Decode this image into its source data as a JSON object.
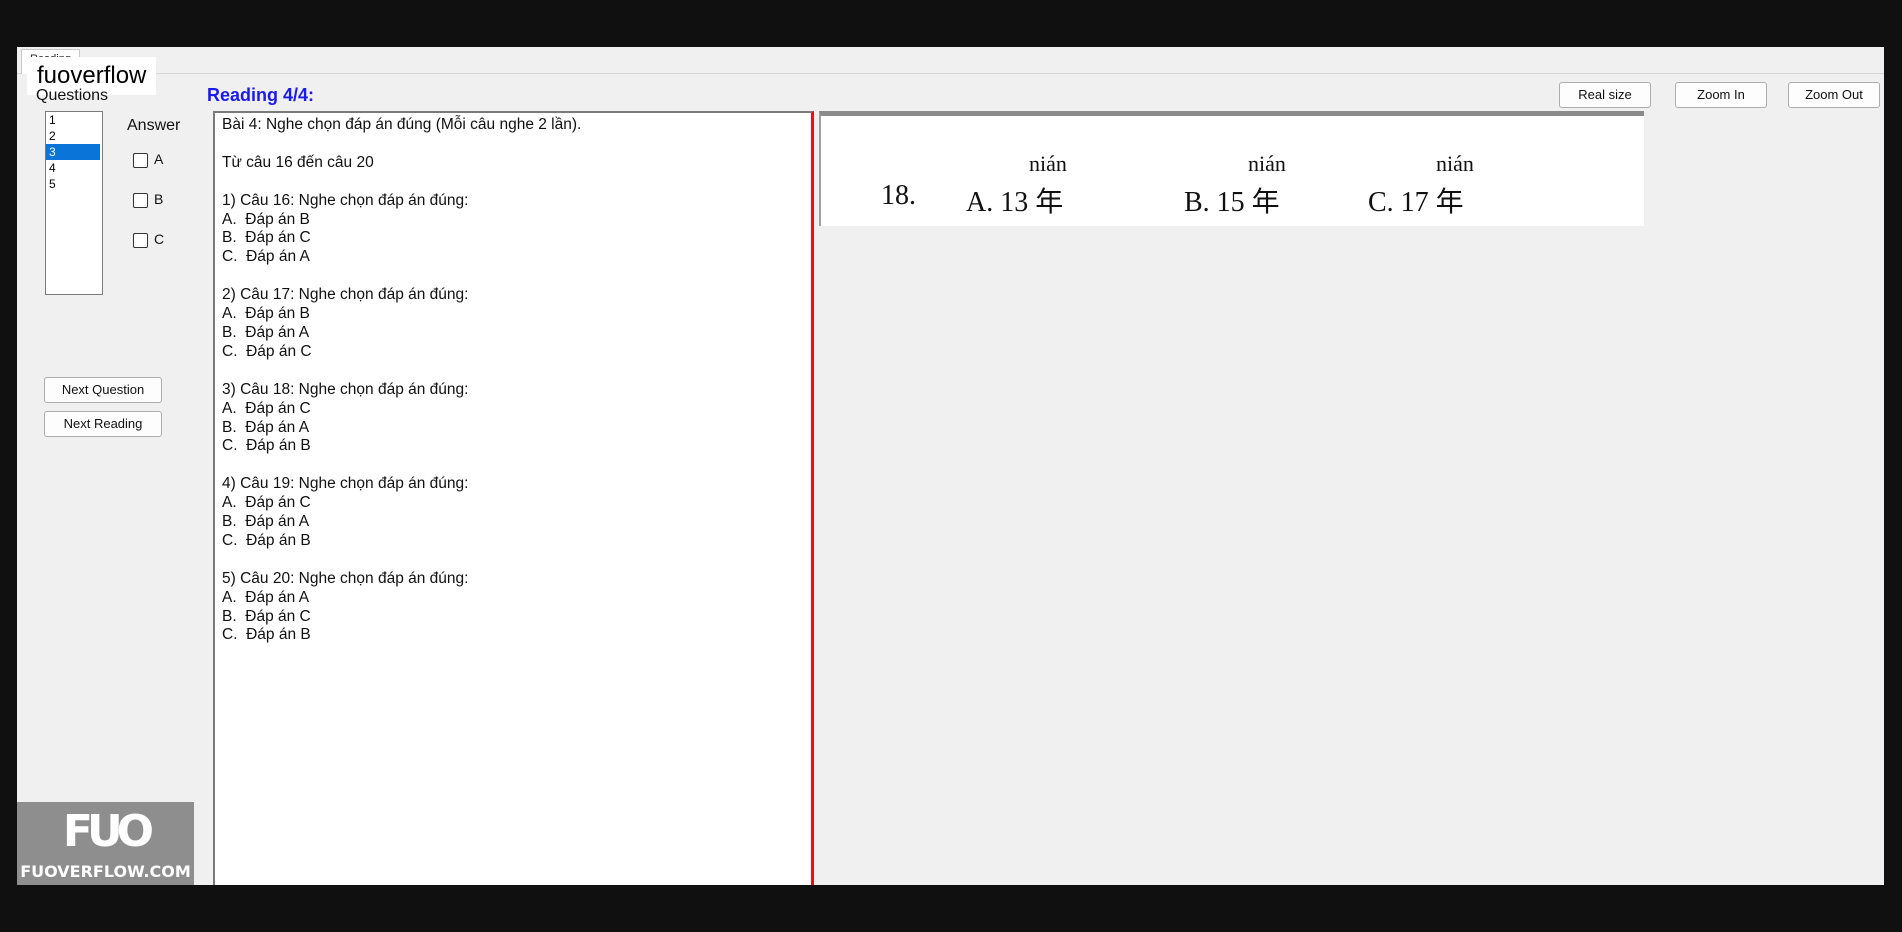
{
  "window": {
    "tab_label": "Reading"
  },
  "watermark": "fuoverflow",
  "questions": {
    "label": "Questions",
    "items": [
      "1",
      "2",
      "3",
      "4",
      "5"
    ],
    "selected": "3"
  },
  "reading": {
    "title": "Reading 4/4:"
  },
  "answer": {
    "label": "Answer",
    "options": [
      "A",
      "B",
      "C"
    ]
  },
  "buttons": {
    "next_question": "Next Question",
    "next_reading": "Next Reading",
    "real_size": "Real size",
    "zoom_in": "Zoom In",
    "zoom_out": "Zoom Out"
  },
  "content": {
    "text": "Bài 4: Nghe chọn đáp án đúng (Mỗi câu nghe 2 lần).\n\nTừ câu 16 đến câu 20\n\n1) Câu 16: Nghe chọn đáp án đúng:\nA.  Đáp án B\nB.  Đáp án C\nC.  Đáp án A\n\n2) Câu 17: Nghe chọn đáp án đúng:\nA.  Đáp án B\nB.  Đáp án A\nC.  Đáp án C\n\n3) Câu 18: Nghe chọn đáp án đúng:\nA.  Đáp án C\nB.  Đáp án A\nC.  Đáp án B\n\n4) Câu 19: Nghe chọn đáp án đúng:\nA.  Đáp án C\nB.  Đáp án A\nC.  Đáp án B\n\n5) Câu 20: Nghe chọn đáp án đúng:\nA.  Đáp án A\nB.  Đáp án C\nC.  Đáp án B"
  },
  "image": {
    "number": "18.",
    "options": [
      {
        "label": "A. 13 年",
        "pinyin": "nián"
      },
      {
        "label": "B. 15 年",
        "pinyin": "nián"
      },
      {
        "label": "C. 17 年",
        "pinyin": "nián"
      }
    ]
  },
  "logo": {
    "mark": "FUO",
    "domain": "FUOVERFLOW.COM"
  }
}
